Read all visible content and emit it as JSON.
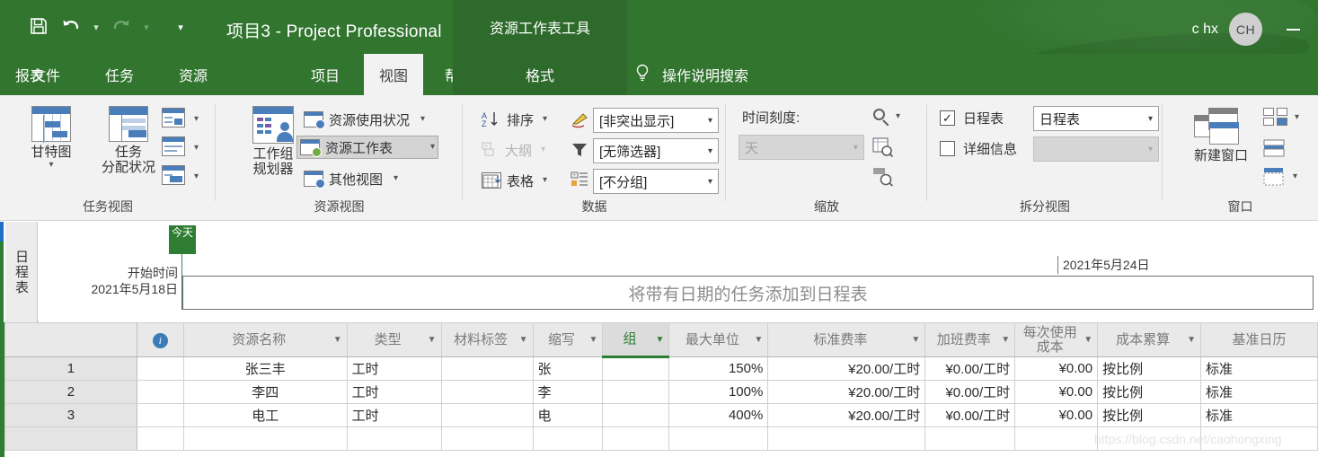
{
  "titlebar": {
    "quick_access": [
      {
        "name": "save-icon",
        "label": "保存"
      },
      {
        "name": "undo-icon",
        "label": "撤消"
      },
      {
        "name": "redo-icon",
        "label": "恢复"
      },
      {
        "name": "customize-qat-icon",
        "label": "自定义快速访问工具栏"
      }
    ],
    "document_title": "项目3  -  Project Professional",
    "contextual_tab_title": "资源工作表工具",
    "account_name": "c hx",
    "avatar_initials": "CH",
    "minimize_label": "最小化"
  },
  "tabs": [
    {
      "label": "文件",
      "active": false
    },
    {
      "label": "任务",
      "active": false
    },
    {
      "label": "资源",
      "active": false
    },
    {
      "label": "报表",
      "active": false
    },
    {
      "label": "项目",
      "active": false
    },
    {
      "label": "视图",
      "active": true
    },
    {
      "label": "帮助",
      "active": false
    },
    {
      "label": "格式",
      "contextual": true
    }
  ],
  "tellme": {
    "icon": "lightbulb-icon",
    "label": "操作说明搜索"
  },
  "ribbon": {
    "groups": [
      {
        "name": "任务视图",
        "buttons": {
          "gantt": "甘特图",
          "task_usage_line1": "任务",
          "task_usage_line2": "分配状况"
        }
      },
      {
        "name": "资源视图",
        "buttons": {
          "team_planner_line1": "工作组",
          "team_planner_line2": "规划器",
          "resource_usage": "资源使用状况",
          "resource_sheet": "资源工作表",
          "other_views": "其他视图"
        }
      },
      {
        "name": "数据",
        "buttons": {
          "sort": "排序",
          "outline": "大纲",
          "tables": "表格"
        },
        "combos": {
          "highlight": "[非突出显示]",
          "filter": "[无筛选器]",
          "group": "[不分组]"
        }
      },
      {
        "name": "缩放",
        "labels": {
          "timescale": "时间刻度:"
        },
        "combos": {
          "timescale_value": "天"
        }
      },
      {
        "name": "拆分视图",
        "checkboxes": [
          {
            "label": "日程表",
            "checked": true
          },
          {
            "label": "详细信息",
            "checked": false
          }
        ],
        "combos": {
          "timeline_view": "日程表",
          "details_view": ""
        }
      },
      {
        "name": "窗口",
        "buttons": {
          "new_window": "新建窗口"
        }
      }
    ]
  },
  "timeline": {
    "side_label": "日程表",
    "today_marker": "今天",
    "start_label": "开始时间",
    "start_date": "2021年5月18日",
    "end_date": "2021年5月24日",
    "empty_hint": "将带有日期的任务添加到日程表"
  },
  "sheet": {
    "info_column_icon": "info-icon",
    "columns": [
      {
        "label": "资源名称",
        "selected": false
      },
      {
        "label": "类型",
        "selected": false
      },
      {
        "label": "材料标签",
        "selected": false
      },
      {
        "label": "缩写",
        "selected": false
      },
      {
        "label": "组",
        "selected": true
      },
      {
        "label": "最大单位",
        "selected": false
      },
      {
        "label": "标准费率",
        "selected": false
      },
      {
        "label": "加班费率",
        "selected": false
      },
      {
        "label": "每次使用\n成本",
        "selected": false
      },
      {
        "label": "成本累算",
        "selected": false
      },
      {
        "label": "基准日历",
        "selected": false
      }
    ],
    "rows": [
      {
        "num": "1",
        "info": "",
        "name": "张三丰",
        "type": "工时",
        "material_label": "",
        "abbr": "张",
        "group": "",
        "max_units": "150%",
        "std_rate": "¥20.00/工时",
        "ot_rate": "¥0.00/工时",
        "cost_per_use": "¥0.00",
        "accrual": "按比例",
        "calendar": "标准"
      },
      {
        "num": "2",
        "info": "",
        "name": "李四",
        "type": "工时",
        "material_label": "",
        "abbr": "李",
        "group": "",
        "max_units": "100%",
        "std_rate": "¥20.00/工时",
        "ot_rate": "¥0.00/工时",
        "cost_per_use": "¥0.00",
        "accrual": "按比例",
        "calendar": "标准"
      },
      {
        "num": "3",
        "info": "",
        "name": "电工",
        "type": "工时",
        "material_label": "",
        "abbr": "电",
        "group": "",
        "max_units": "400%",
        "std_rate": "¥20.00/工时",
        "ot_rate": "¥0.00/工时",
        "cost_per_use": "¥0.00",
        "accrual": "按比例",
        "calendar": "标准"
      },
      {
        "num": "",
        "info": "",
        "name": "",
        "type": "",
        "material_label": "",
        "abbr": "",
        "group": "",
        "max_units": "",
        "std_rate": "",
        "ot_rate": "",
        "cost_per_use": "",
        "accrual": "",
        "calendar": ""
      }
    ]
  },
  "watermark": "https://blog.csdn.net/caohongxing",
  "colors": {
    "brand_green": "#31752f",
    "contextual_green": "#2d6a2b",
    "accent_green": "#2e7d32",
    "ribbon_bg": "#f2f2f2",
    "icon_blue": "#4a7ebb"
  }
}
